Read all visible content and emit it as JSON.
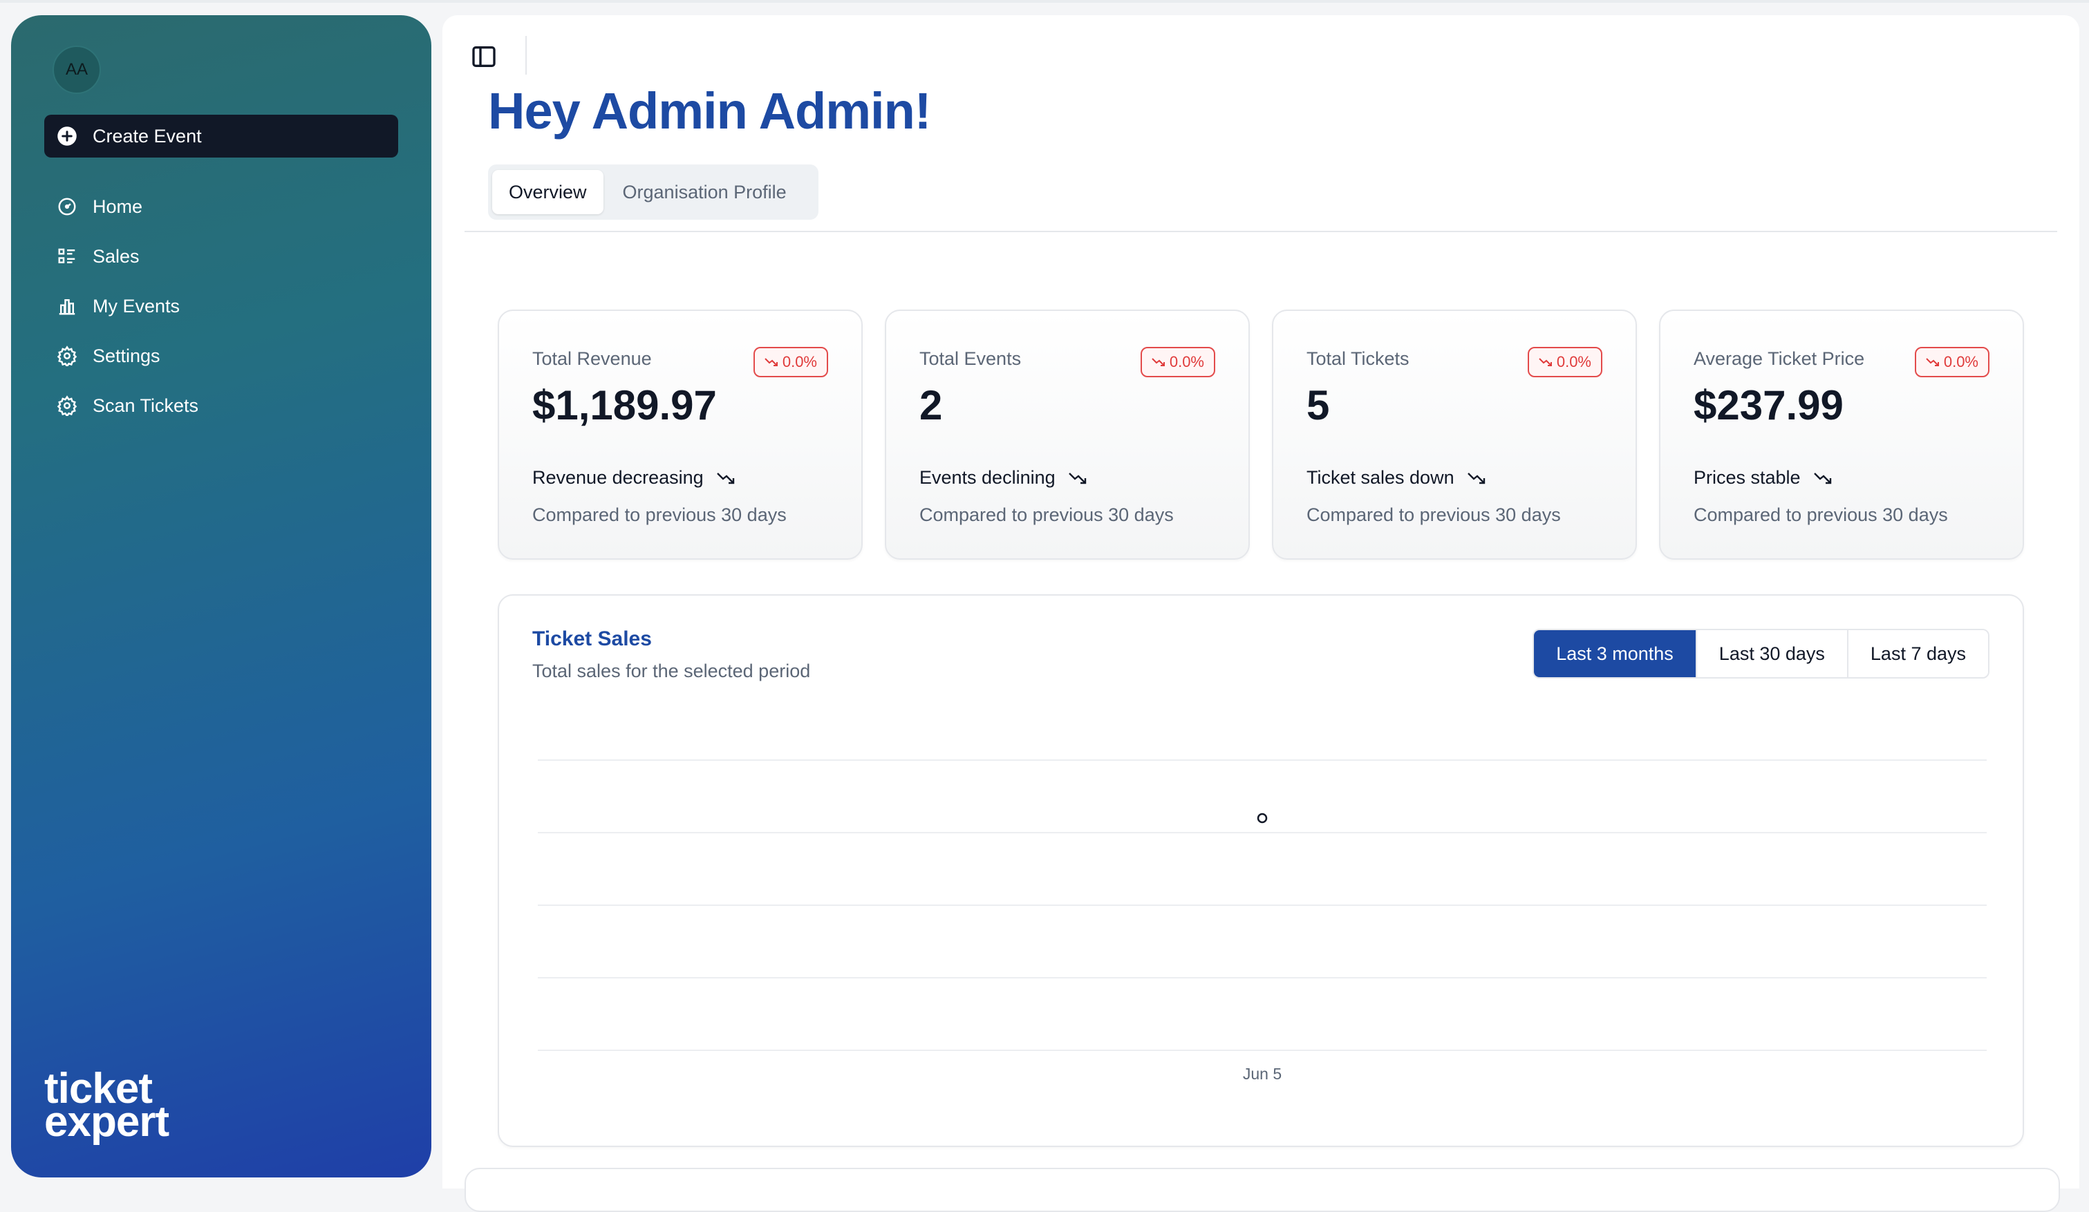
{
  "sidebar": {
    "avatar_initials": "AA",
    "primary_action": "Create Event",
    "items": [
      {
        "label": "Home",
        "icon": "gauge-icon"
      },
      {
        "label": "Sales",
        "icon": "list-icon"
      },
      {
        "label": "My Events",
        "icon": "bar-chart-icon"
      },
      {
        "label": "Settings",
        "icon": "gear-icon"
      },
      {
        "label": "Scan Tickets",
        "icon": "gear-icon"
      }
    ],
    "brand": {
      "line1": "ticket",
      "line2": "expert"
    }
  },
  "header": {
    "greeting": "Hey Admin Admin!",
    "tabs": [
      {
        "label": "Overview",
        "active": true
      },
      {
        "label": "Organisation Profile",
        "active": false
      }
    ]
  },
  "stats": [
    {
      "label": "Total Revenue",
      "badge": "0.0%",
      "value": "$1,189.97",
      "trend": "Revenue decreasing",
      "sub": "Compared to previous 30 days"
    },
    {
      "label": "Total Events",
      "badge": "0.0%",
      "value": "2",
      "trend": "Events declining",
      "sub": "Compared to previous 30 days"
    },
    {
      "label": "Total Tickets",
      "badge": "0.0%",
      "value": "5",
      "trend": "Ticket sales down",
      "sub": "Compared to previous 30 days"
    },
    {
      "label": "Average Ticket Price",
      "badge": "0.0%",
      "value": "$237.99",
      "trend": "Prices stable",
      "sub": "Compared to previous 30 days"
    }
  ],
  "chart": {
    "title": "Ticket Sales",
    "subtitle": "Total sales for the selected period",
    "ranges": [
      {
        "label": "Last 3 months",
        "active": true
      },
      {
        "label": "Last 30 days",
        "active": false
      },
      {
        "label": "Last 7 days",
        "active": false
      }
    ]
  },
  "chart_data": {
    "type": "line",
    "x": [
      "Jun 5"
    ],
    "series": [
      {
        "values": [
          1
        ]
      }
    ],
    "grid": true,
    "colors": {
      "point": "#111827",
      "grid": "#eceef1"
    }
  },
  "colors": {
    "accent": "#1d4aa3",
    "danger": "#e03b3b",
    "dark": "#111827"
  }
}
